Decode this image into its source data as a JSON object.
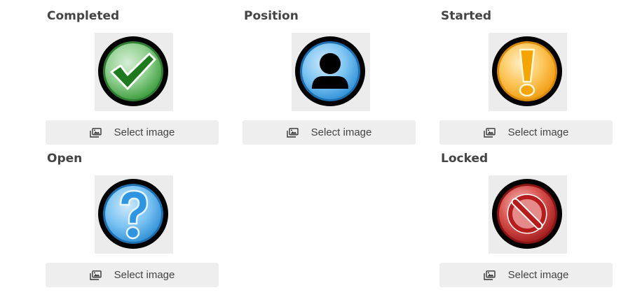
{
  "panels": [
    {
      "title": "Completed",
      "icon": "check-icon",
      "button_label": "Select image"
    },
    {
      "title": "Position",
      "icon": "person-icon",
      "button_label": "Select image"
    },
    {
      "title": "Started",
      "icon": "exclamation-icon",
      "button_label": "Select image"
    },
    {
      "title": "Open",
      "icon": "question-icon",
      "button_label": "Select image"
    },
    {
      "title": "Locked",
      "icon": "prohibited-icon",
      "button_label": "Select image"
    }
  ],
  "colors": {
    "green": "#4caf50",
    "blue": "#5ab4ec",
    "orange": "#fbb531",
    "red": "#c62828",
    "button_bg": "#eeeeee",
    "thumb_bg": "#ececec"
  }
}
